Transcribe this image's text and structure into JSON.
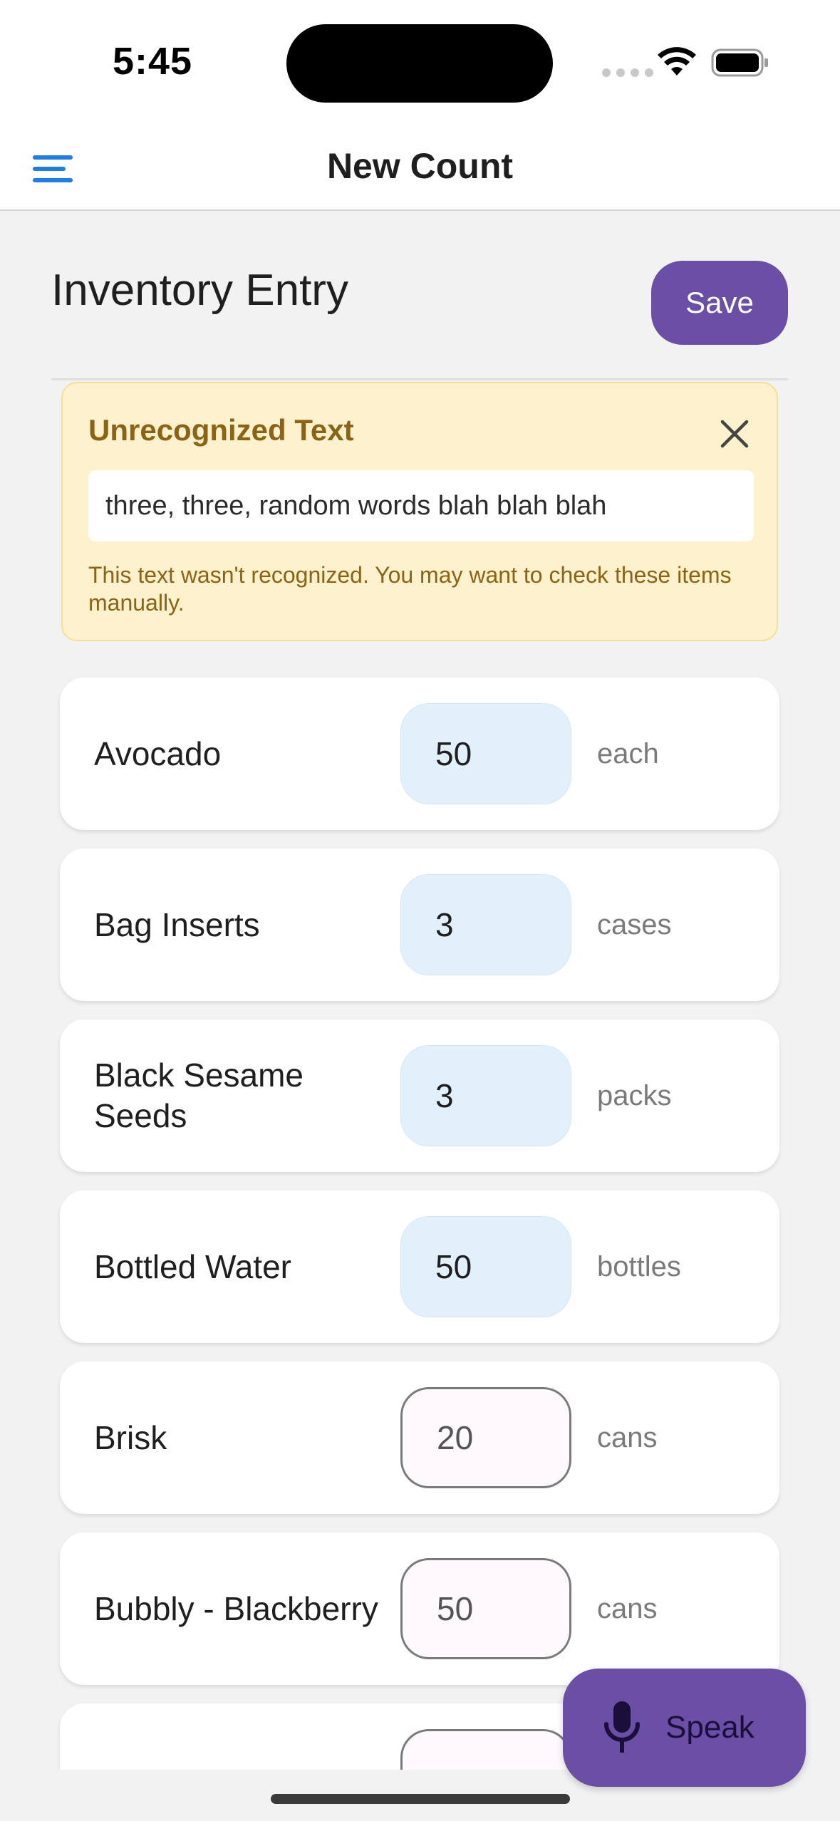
{
  "status_bar": {
    "time": "5:45"
  },
  "nav": {
    "title": "New Count",
    "menu_icon": "hamburger-menu-icon",
    "accent_color": "#1e7ee6"
  },
  "page": {
    "title": "Inventory Entry",
    "save_label": "Save"
  },
  "warning": {
    "title": "Unrecognized Text",
    "text_value": "three, three, random words blah blah blah",
    "message": "This text wasn't recognized. You may want to check these items manually.",
    "close_icon": "close-icon"
  },
  "items": [
    {
      "name": "Avocado",
      "quantity": "50",
      "unit": "each",
      "style": "filled"
    },
    {
      "name": "Bag Inserts",
      "quantity": "3",
      "unit": "cases",
      "style": "filled"
    },
    {
      "name": "Black Sesame Seeds",
      "quantity": "3",
      "unit": "packs",
      "style": "filled"
    },
    {
      "name": "Bottled Water",
      "quantity": "50",
      "unit": "bottles",
      "style": "filled"
    },
    {
      "name": "Brisk",
      "quantity": "20",
      "unit": "cans",
      "style": "outlined"
    },
    {
      "name": "Bubbly - Blackberry",
      "quantity": "50",
      "unit": "cans",
      "style": "outlined"
    }
  ],
  "fab": {
    "label": "Speak",
    "icon": "microphone-icon"
  },
  "colors": {
    "primary": "#6b4ea6",
    "warning_bg": "#fdf2cd",
    "warning_text": "#8a6414",
    "filled_field": "#e2f0fc"
  }
}
